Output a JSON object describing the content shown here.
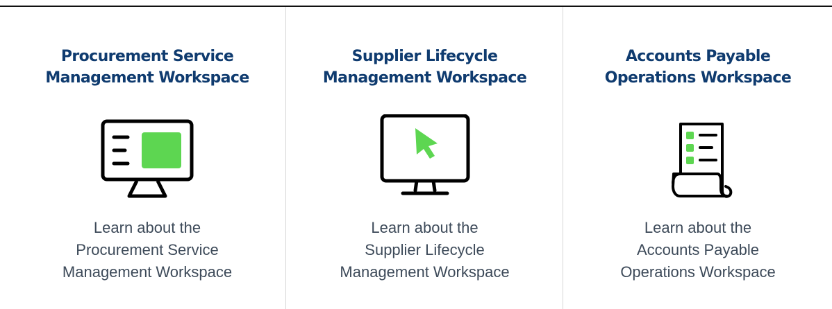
{
  "colors": {
    "title": "#0f3b6f",
    "description": "#3d4a59",
    "accent": "#5dd651",
    "icon_stroke": "#000000",
    "divider": "#d6d6d6"
  },
  "cards": [
    {
      "title": "Procurement Service\nManagement Workspace",
      "icon": "monitor-dashboard-icon",
      "description": "Learn about the\nProcurement Service\nManagement Workspace"
    },
    {
      "title": "Supplier Lifecycle\nManagement Workspace",
      "icon": "monitor-cursor-icon",
      "description": "Learn about the\nSupplier Lifecycle\nManagement Workspace"
    },
    {
      "title": "Accounts Payable\nOperations Workspace",
      "icon": "document-list-icon",
      "description": "Learn about the\nAccounts Payable\nOperations Workspace"
    }
  ]
}
